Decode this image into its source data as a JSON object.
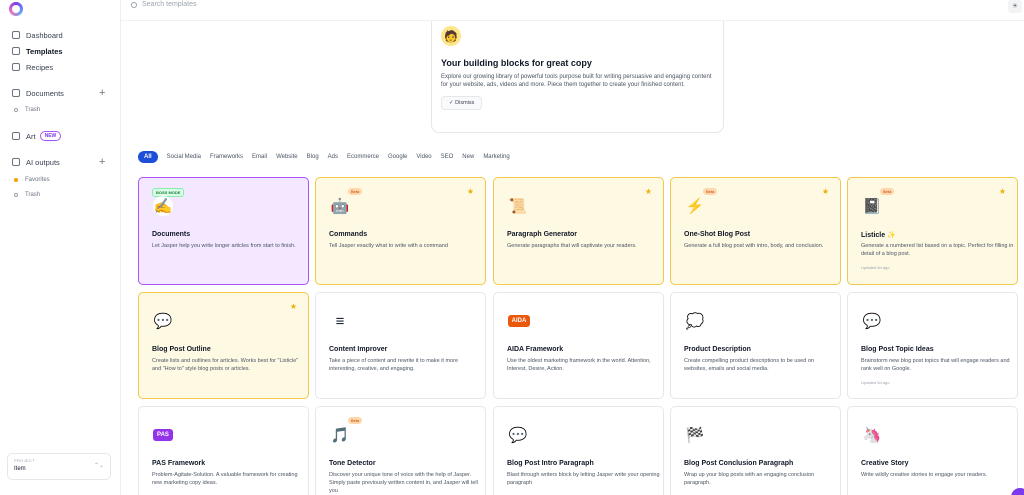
{
  "sidebar": {
    "nav": [
      {
        "label": "Dashboard",
        "icon": "home-icon"
      },
      {
        "label": "Templates",
        "icon": "grid-icon"
      },
      {
        "label": "Recipes",
        "icon": "recipe-icon"
      }
    ],
    "documents": {
      "label": "Documents",
      "icon": "document-icon",
      "plus": "+",
      "sub": [
        {
          "label": "Trash"
        }
      ]
    },
    "art": {
      "label": "Art",
      "icon": "image-icon",
      "badge": "NEW"
    },
    "ai_outputs": {
      "label": "AI outputs",
      "icon": "archive-icon",
      "plus": "+",
      "sub": [
        {
          "label": "Favorites"
        },
        {
          "label": "Trash"
        }
      ]
    },
    "project": {
      "label": "PROJECT",
      "value": "Item",
      "chevron": "⌃⌄"
    }
  },
  "search": {
    "placeholder": "Search templates"
  },
  "top_right": {
    "icon": "sun-icon",
    "glyph": "☀"
  },
  "intro": {
    "icon": "jasper-avatar-icon",
    "title": "Your building blocks for great copy",
    "text": "Explore our growing library of powerful tools purpose built for writing persuasive and engaging content for your website, ads, videos and more. Piece them together to create your finished content.",
    "dismiss": "✓  Dismiss"
  },
  "filters": [
    "All",
    "Social Media",
    "Frameworks",
    "Email",
    "Website",
    "Blog",
    "Ads",
    "Ecommerce",
    "Google",
    "Video",
    "SEO",
    "New",
    "Marketing"
  ],
  "active_filter": "All",
  "colors": {
    "accent": "#1d4ed8",
    "featured_bg": "#fef9e3",
    "featured_border": "#f0c94a",
    "boss_bg": "#f3e8ff",
    "boss_border": "#a855f7"
  },
  "cards": [
    {
      "title": "Documents",
      "desc": "Let Jasper help you write longer articles from start to finish.",
      "icon": "pencil-icon",
      "glyph": "✍",
      "style": "p",
      "boss": "BOSS MODE"
    },
    {
      "title": "Commands",
      "desc": "Tell Jasper exactly what to write with a command",
      "icon": "robot-icon",
      "glyph": "🤖",
      "style": "y",
      "beta": "Beta",
      "star": "★"
    },
    {
      "title": "Paragraph Generator",
      "desc": "Generate paragraphs that will captivate your readers.",
      "icon": "scroll-icon",
      "glyph": "📜",
      "style": "y",
      "star": "★"
    },
    {
      "title": "One-Shot Blog Post",
      "desc": "Generate a full blog post with intro, body, and conclusion.",
      "icon": "lightning-icon",
      "glyph": "⚡",
      "style": "y",
      "beta": "Beta",
      "star": "★"
    },
    {
      "title": "Listicle ✨",
      "desc": "Generate a numbered list based on a topic. Perfect for filling in detail of a blog post.",
      "icon": "notebook-icon",
      "glyph": "📓",
      "style": "y",
      "beta": "Beta",
      "star": "★",
      "updated": "Updated 5d ago"
    },
    {
      "title": "Blog Post Outline",
      "desc": "Create lists and outlines for articles. Works best for \"Listicle\" and \"How to\" style blog posts or articles.",
      "icon": "chat-icon",
      "glyph": "💬",
      "style": "y",
      "star": "★"
    },
    {
      "title": "Content Improver",
      "desc": "Take a piece of content and rewrite it to make it more interesting, creative, and engaging.",
      "icon": "lines-icon",
      "glyph": "≡",
      "style": "w"
    },
    {
      "title": "AIDA Framework",
      "desc": "Use the oldest marketing framework in the world. Attention, Interest, Desire, Action.",
      "icon": "aida-icon",
      "glyph": "AIDA",
      "style": "w"
    },
    {
      "title": "Product Description",
      "desc": "Create compelling product descriptions to be used on websites, emails and social media.",
      "icon": "speech-bubble-icon",
      "glyph": "💭",
      "style": "w"
    },
    {
      "title": "Blog Post Topic Ideas",
      "desc": "Brainstorm new blog post topics that will engage readers and rank well on Google.",
      "icon": "chat-icon",
      "glyph": "💬",
      "style": "w",
      "updated": "Updated 5d ago"
    },
    {
      "title": "PAS Framework",
      "desc": "Problem-Agitate-Solution. A valuable framework for creating new marketing copy ideas.",
      "icon": "pas-icon",
      "glyph": "PAS",
      "style": "w"
    },
    {
      "title": "Tone Detector",
      "desc": "Discover your unique tone of voice with the help of Jasper. Simply paste previously written content in, and Jasper will tell you",
      "icon": "music-icon",
      "glyph": "🎵",
      "style": "w",
      "beta": "Beta"
    },
    {
      "title": "Blog Post Intro Paragraph",
      "desc": "Blast through writers block by letting Jasper write your opening paragraph",
      "icon": "chat-icon",
      "glyph": "💬",
      "style": "w"
    },
    {
      "title": "Blog Post Conclusion Paragraph",
      "desc": "Wrap up your blog posts with an engaging conclusion paragraph.",
      "icon": "flag-icon",
      "glyph": "🏁",
      "style": "w"
    },
    {
      "title": "Creative Story",
      "desc": "Write wildly creative stories to engage your readers.",
      "icon": "unicorn-icon",
      "glyph": "🦄",
      "style": "w"
    }
  ]
}
